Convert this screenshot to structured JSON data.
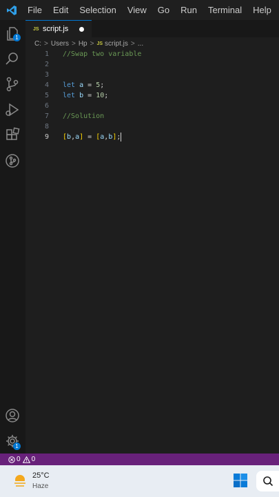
{
  "menubar": {
    "items": [
      "File",
      "Edit",
      "Selection",
      "View",
      "Go",
      "Run",
      "Terminal",
      "Help"
    ]
  },
  "activity": {
    "explorer_badge": "1",
    "settings_badge": "1"
  },
  "tab": {
    "lang": "JS",
    "name": "script.js"
  },
  "breadcrumb": {
    "parts": [
      "C:",
      "Users",
      "Hp"
    ],
    "lang": "JS",
    "file": "script.js",
    "more": "..."
  },
  "editor": {
    "lines": [
      {
        "num": "1",
        "text": "//Swap two variable"
      },
      {
        "num": "2",
        "text": ""
      },
      {
        "num": "3",
        "text": ""
      },
      {
        "num": "4",
        "text": "let a = 5;"
      },
      {
        "num": "5",
        "text": "let b = 10;"
      },
      {
        "num": "6",
        "text": ""
      },
      {
        "num": "7",
        "text": "//Solution"
      },
      {
        "num": "8",
        "text": ""
      },
      {
        "num": "9",
        "text": "[b,a] = [a,b];"
      }
    ]
  },
  "status": {
    "errors": "0",
    "warnings": "0",
    "color": "#68217a"
  },
  "taskbar": {
    "temperature": "25°C",
    "condition": "Haze"
  }
}
